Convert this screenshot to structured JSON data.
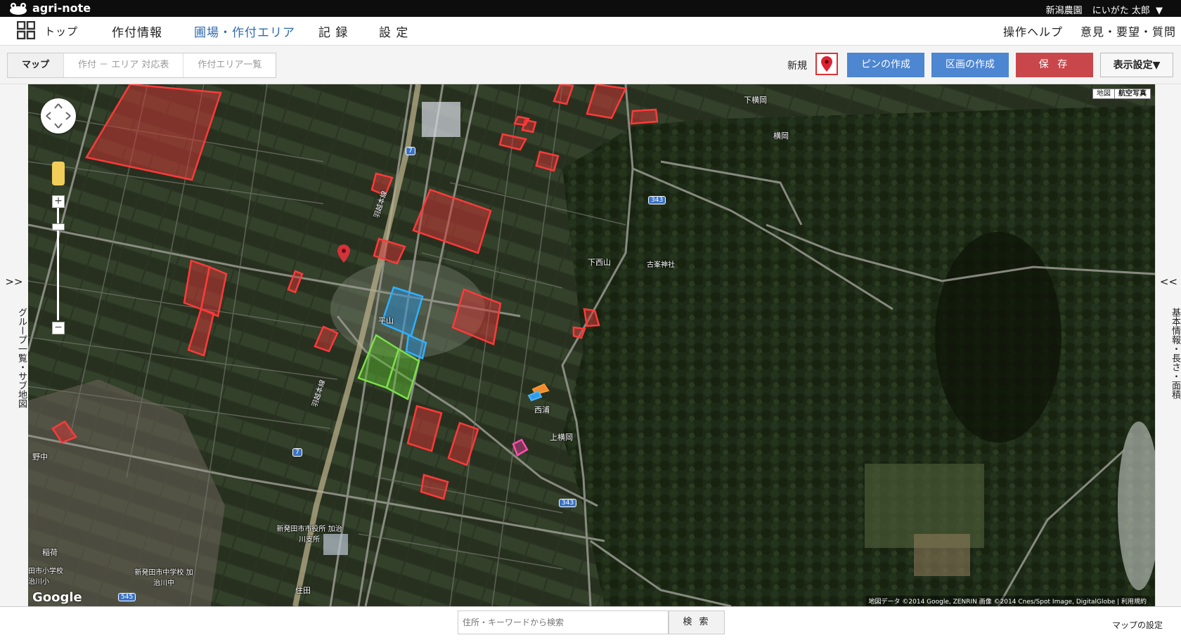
{
  "app": {
    "logo_text": "agri-note",
    "farm_name": "新潟農園",
    "user_name": "にいがた 太郎",
    "user_menu_icon": "▼"
  },
  "nav": {
    "top_label": "トップ",
    "items": [
      "作付情報",
      "圃場・作付エリア",
      "記 録",
      "設 定"
    ],
    "active_index": 1,
    "help": "操作ヘルプ",
    "feedback": "意見・要望・質問"
  },
  "toolbar": {
    "subtabs": [
      "マップ",
      "作付 － エリア 対応表",
      "作付エリア一覧"
    ],
    "active_subtab": 0,
    "new_label": "新規",
    "pin_button": "ピンの作成",
    "area_button": "区画の作成",
    "save_button": "保 存",
    "display_button": "表示設定▼"
  },
  "side": {
    "left_arrow": ">>",
    "left_text": "グループ一覧・サブ地図",
    "right_arrow": "<<",
    "right_text": "基本情報・長さ・面積"
  },
  "map": {
    "maptype": [
      "地図",
      "航空写真"
    ],
    "selected_maptype": 1,
    "labels": [
      "下横岡",
      "横岡",
      "下西山",
      "古峯神社",
      "平山",
      "西浦",
      "上横岡",
      "野中",
      "新発田市市役所 加治川支所",
      "稲荷",
      "住田",
      "田市小学校 治川小",
      "新発田市中学校 加治川中",
      "羽越本線",
      "羽越本線"
    ],
    "route_numbers": [
      "7",
      "7",
      "343",
      "343",
      "545"
    ],
    "copyright": "地図データ ©2014 Google, ZENRIN 画像 ©2014 Cnes/Spot Image, DigitalGlobe | 利用規約",
    "google_logo": "Google",
    "colors": {
      "field_red": "#e03c3c",
      "field_blue": "#2f9ee8",
      "field_green": "#6ccb3a",
      "field_pink": "#e0449a",
      "field_orange": "#f08a2a"
    }
  },
  "bottom": {
    "search_placeholder": "住所・キーワードから検索",
    "search_button": "検 索",
    "map_settings": "マップの設定"
  }
}
